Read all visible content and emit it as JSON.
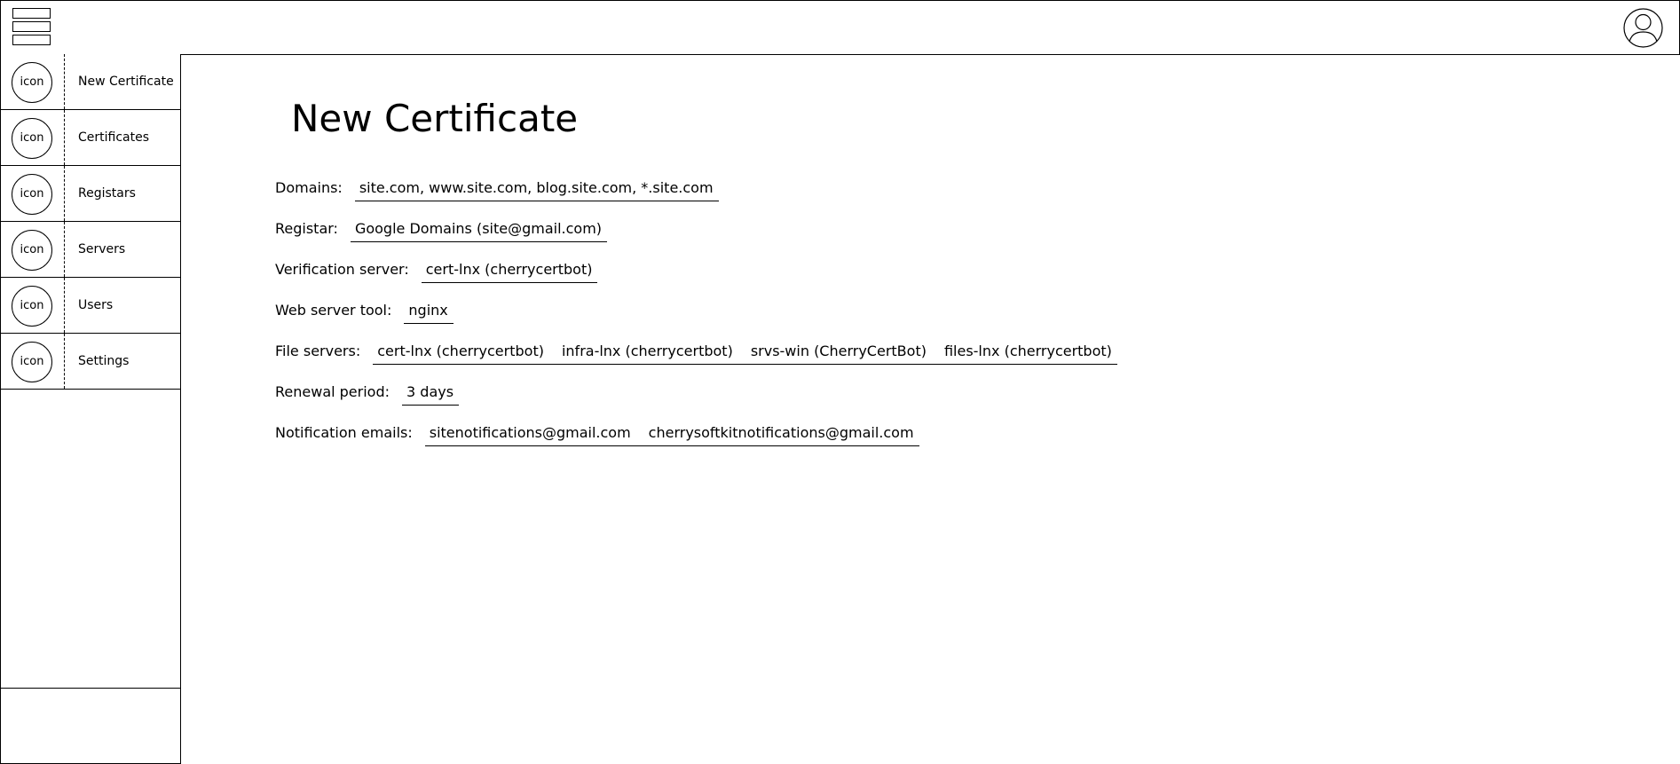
{
  "header": {
    "menu_icon": "hamburger-menu-icon",
    "avatar_icon": "user-avatar-icon"
  },
  "sidebar": {
    "items": [
      {
        "icon": "icon",
        "label": "New Certificate"
      },
      {
        "icon": "icon",
        "label": "Certificates"
      },
      {
        "icon": "icon",
        "label": "Registars"
      },
      {
        "icon": "icon",
        "label": "Servers"
      },
      {
        "icon": "icon",
        "label": "Users"
      },
      {
        "icon": "icon",
        "label": "Settings"
      }
    ]
  },
  "main": {
    "title": "New Certificate",
    "fields": {
      "domains": {
        "label": "Domains:",
        "value": "site.com, www.site.com, blog.site.com, *.site.com"
      },
      "registar": {
        "label": "Registar:",
        "value": "Google Domains (site@gmail.com)"
      },
      "verification_server": {
        "label": "Verification server:",
        "value": "cert-lnx (cherrycertbot)"
      },
      "web_server_tool": {
        "label": "Web server tool:",
        "value": "nginx"
      },
      "file_servers": {
        "label": "File servers:",
        "values": [
          "cert-lnx (cherrycertbot)",
          "infra-lnx (cherrycertbot)",
          "srvs-win (CherryCertBot)",
          "files-lnx (cherrycertbot)"
        ]
      },
      "renewal_period": {
        "label": "Renewal period:",
        "value": "3 days"
      },
      "notification_emails": {
        "label": "Notification emails:",
        "values": [
          "sitenotifications@gmail.com",
          "cherrysoftkitnotifications@gmail.com"
        ]
      }
    }
  }
}
